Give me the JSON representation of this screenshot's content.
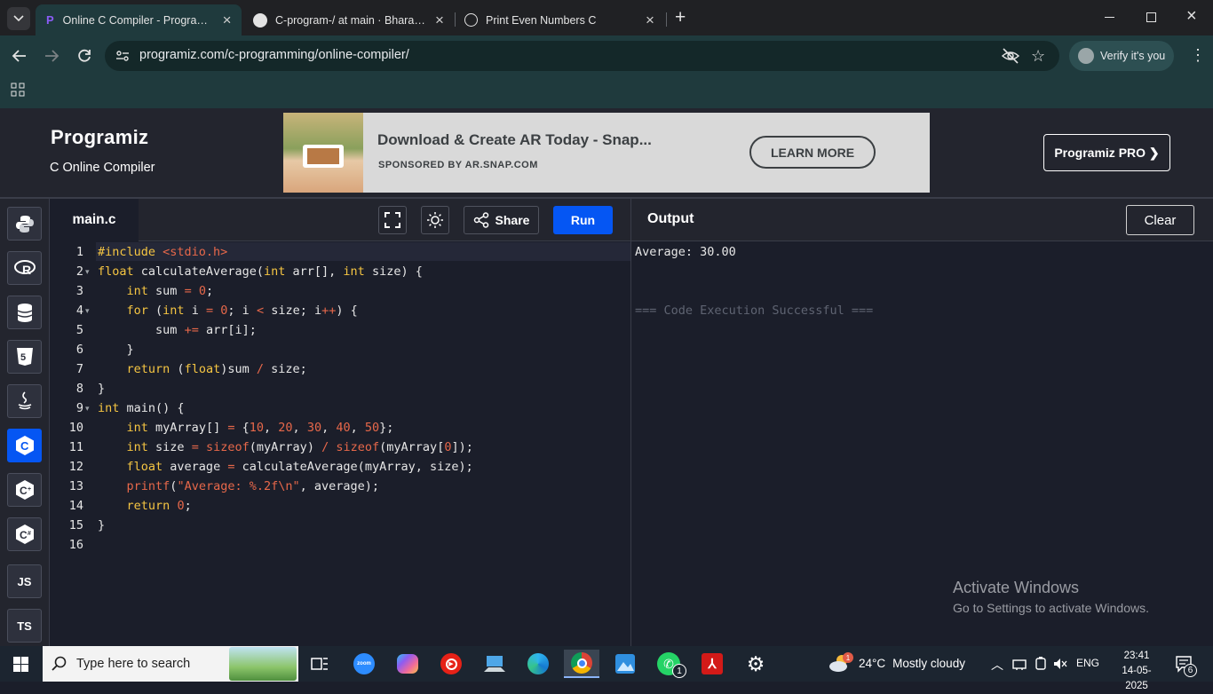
{
  "browser": {
    "tabs": [
      {
        "title": "Online C Compiler - Programiz",
        "active": true
      },
      {
        "title": "C-program-/ at main · Bharathw",
        "active": false
      },
      {
        "title": "Print Even Numbers C",
        "active": false
      }
    ],
    "url": "programiz.com/c-programming/online-compiler/",
    "verify_label": "Verify it's you"
  },
  "site": {
    "logo": "Programiz",
    "subtitle": "C Online Compiler",
    "pro_button": "Programiz PRO ❯"
  },
  "ad": {
    "title": "Download & Create AR Today - Snap...",
    "sponsor": "SPONSORED BY AR.SNAP.COM",
    "button": "LEARN MORE"
  },
  "sidebar": {
    "languages": [
      {
        "name": "python",
        "label": ""
      },
      {
        "name": "r",
        "label": ""
      },
      {
        "name": "sql",
        "label": ""
      },
      {
        "name": "html",
        "label": ""
      },
      {
        "name": "java",
        "label": ""
      },
      {
        "name": "c",
        "label": "",
        "active": true
      },
      {
        "name": "cpp",
        "label": ""
      },
      {
        "name": "csharp",
        "label": ""
      },
      {
        "name": "js",
        "label": "JS"
      },
      {
        "name": "ts",
        "label": "TS"
      }
    ]
  },
  "editor": {
    "filename": "main.c",
    "share_label": "Share",
    "run_label": "Run",
    "line_numbers": [
      "1",
      "2",
      "3",
      "4",
      "5",
      "6",
      "7",
      "8",
      "9",
      "10",
      "11",
      "12",
      "13",
      "14",
      "15",
      "16"
    ],
    "foldable_lines": [
      2,
      4,
      9
    ]
  },
  "code_lines": [
    "#include <stdio.h>",
    "float calculateAverage(int arr[], int size) {",
    "    int sum = 0;",
    "    for (int i = 0; i < size; i++) {",
    "        sum += arr[i];",
    "    }",
    "    return (float)sum / size;",
    "}",
    "int main() {",
    "    int myArray[] = {10, 20, 30, 40, 50};",
    "    int size = sizeof(myArray) / sizeof(myArray[0]);",
    "    float average = calculateAverage(myArray, size);",
    "    printf(\"Average: %.2f\\n\", average);",
    "    return 0;",
    "}",
    ""
  ],
  "output": {
    "title": "Output",
    "clear_label": "Clear",
    "lines": [
      "Average: 30.00",
      "=== Code Execution Successful ==="
    ]
  },
  "watermark": {
    "line1": "Activate Windows",
    "line2": "Go to Settings to activate Windows."
  },
  "taskbar": {
    "search_placeholder": "Type here to search",
    "weather_temp": "24°C",
    "weather_desc": "Mostly cloudy",
    "language": "ENG",
    "time": "23:41",
    "date": "14-05-2025",
    "notification_count": "6",
    "whatsapp_badge": "1",
    "weather_badge": "1"
  },
  "colors": {
    "accent": "#0556f3",
    "editor_bg": "#1b1e2a",
    "keyword": "#f5c542",
    "literal": "#e7684a"
  }
}
